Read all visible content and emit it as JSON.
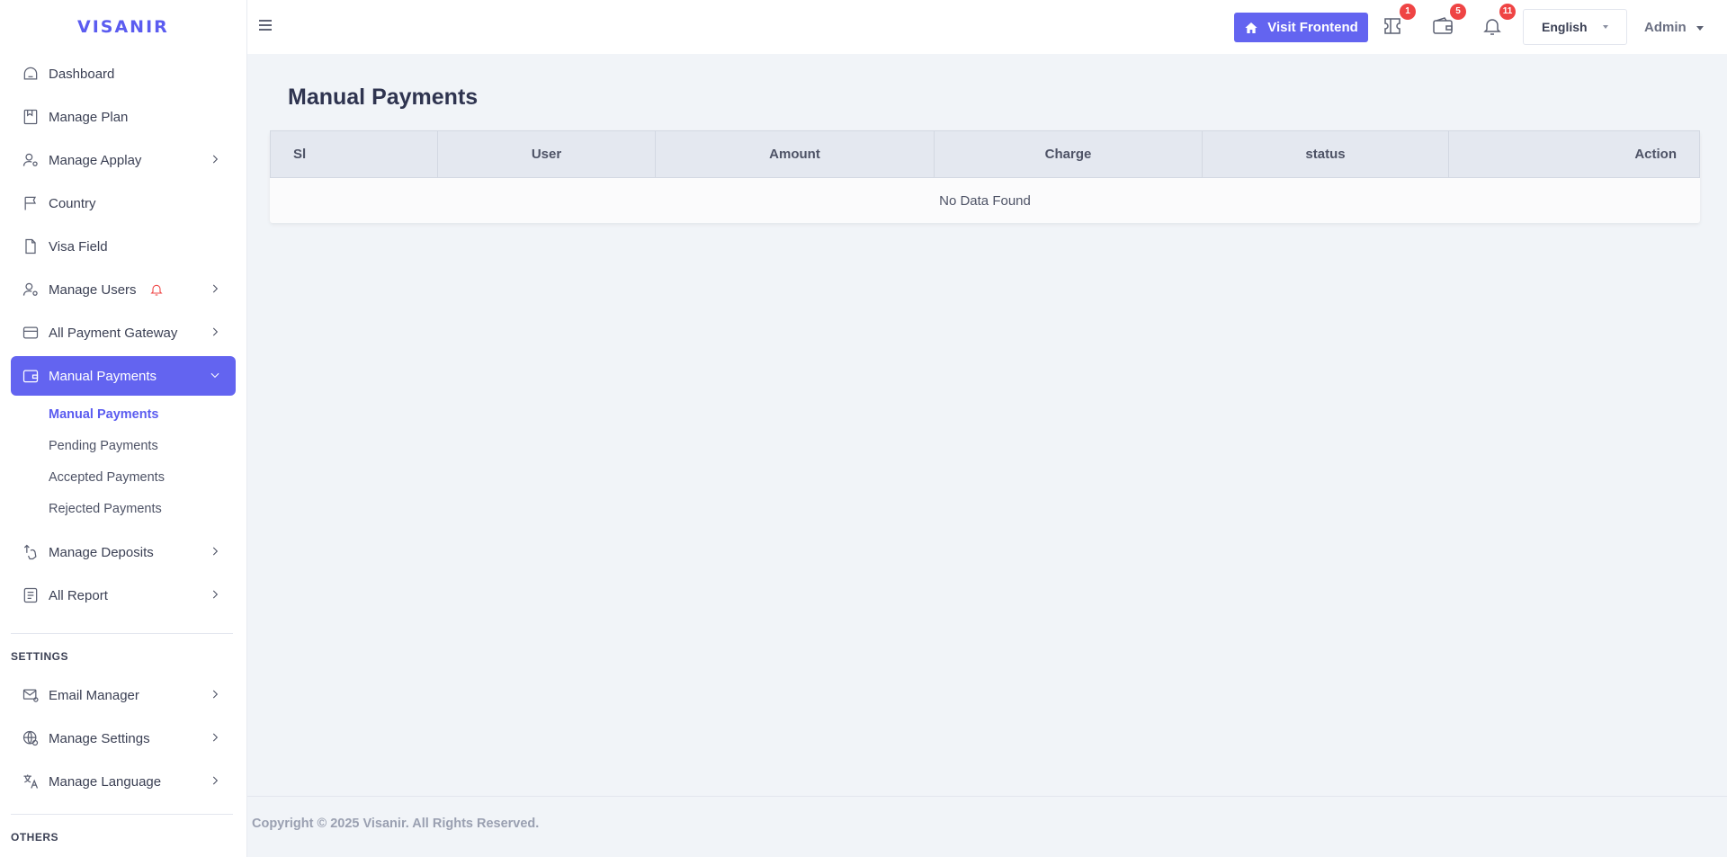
{
  "brand": "VISANIR",
  "sidebar": {
    "items": [
      {
        "label": "Dashboard",
        "icon": "dashboard-icon"
      },
      {
        "label": "Manage Plan",
        "icon": "plan-icon"
      },
      {
        "label": "Manage Applay",
        "icon": "user-gear-icon"
      },
      {
        "label": "Country",
        "icon": "flag-icon"
      },
      {
        "label": "Visa Field",
        "icon": "file-icon"
      },
      {
        "label": "Manage Users",
        "icon": "user-gear-icon"
      },
      {
        "label": "All Payment Gateway",
        "icon": "card-icon"
      },
      {
        "label": "Manual Payments",
        "icon": "wallet-icon"
      },
      {
        "label": "Manage Deposits",
        "icon": "deposit-icon"
      },
      {
        "label": "All Report",
        "icon": "report-icon"
      }
    ],
    "manual_payments_sub": [
      "Manual Payments",
      "Pending Payments",
      "Accepted Payments",
      "Rejected Payments"
    ],
    "settings_label": "SETTINGS",
    "settings_items": [
      {
        "label": "Email Manager",
        "icon": "email-gear-icon"
      },
      {
        "label": "Manage Settings",
        "icon": "globe-gear-icon"
      },
      {
        "label": "Manage Language",
        "icon": "translate-icon"
      }
    ],
    "others_label": "OTHERS"
  },
  "topbar": {
    "visit_label": "Visit Frontend",
    "ticket_badge": "1",
    "wallet_badge": "5",
    "bell_badge": "11",
    "language": "English",
    "user": "Admin"
  },
  "main": {
    "title": "Manual Payments",
    "columns": [
      "Sl",
      "User",
      "Amount",
      "Charge",
      "status",
      "Action"
    ],
    "empty_text": "No Data Found"
  },
  "footer": {
    "text": "Copyright © 2025 Visanir. All Rights Reserved."
  },
  "colors": {
    "accent": "#6364f0",
    "badge": "#ef4444"
  }
}
